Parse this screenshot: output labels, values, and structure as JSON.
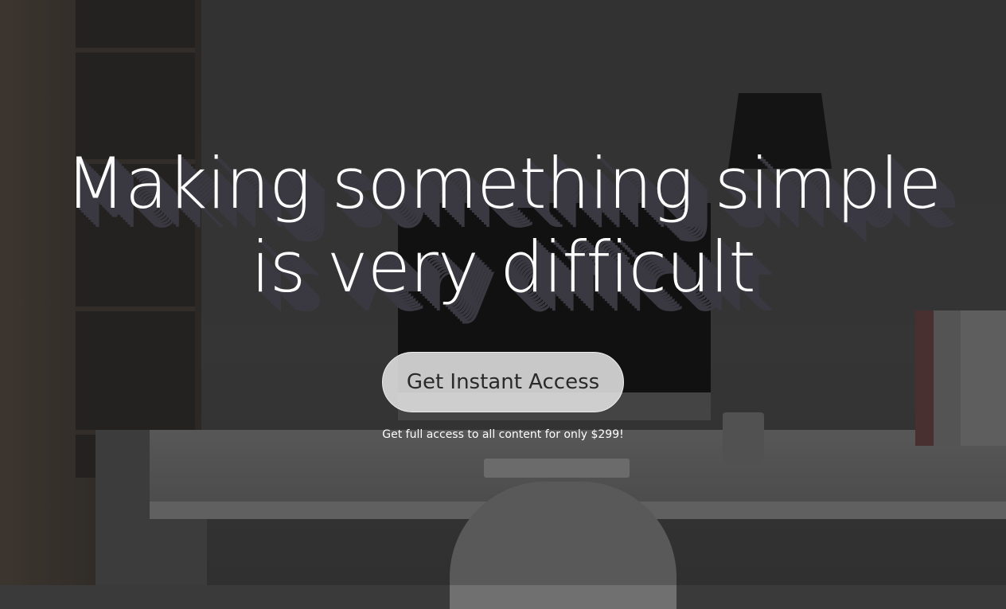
{
  "hero": {
    "headline_line1": "Making something simple",
    "headline_line2": "is very difficult",
    "cta_label": "Get Instant Access",
    "subtext": "Get full access to all content for only $299!"
  },
  "background": {
    "description_icon": "desk-workspace-photo"
  },
  "colors": {
    "text": "#ffffff",
    "button_bg": "#e1e1e1",
    "button_text": "#2a2a2a",
    "headline_shadow": "#3a3840"
  }
}
